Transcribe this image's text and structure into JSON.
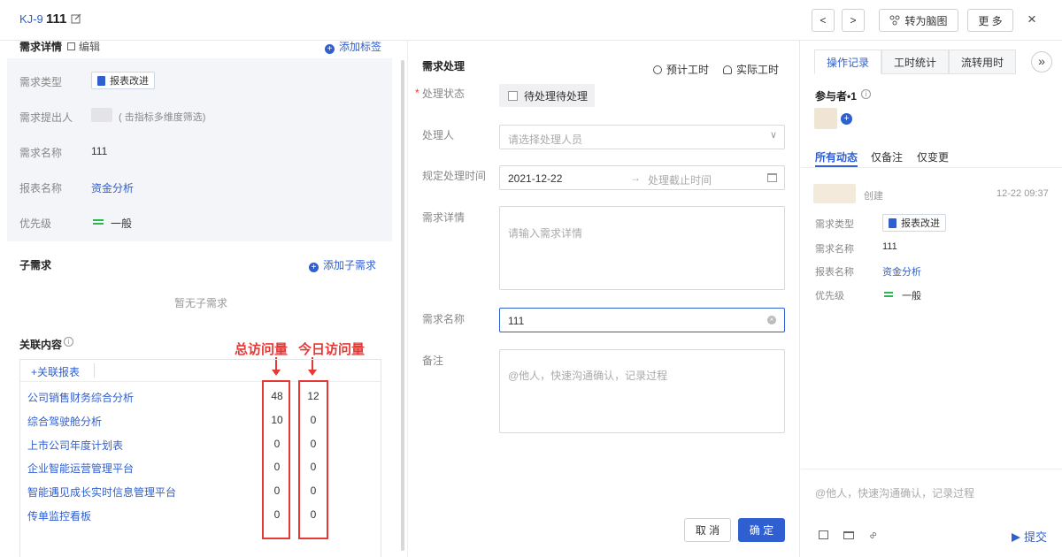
{
  "header": {
    "code": "KJ-9",
    "title": "111",
    "prev": "<",
    "next": ">",
    "mindmap": "转为脑图",
    "more": "更 多",
    "close": "×"
  },
  "detail": {
    "title": "需求详情",
    "edit": "编辑",
    "add_tag": "添加标签",
    "type_label": "需求类型",
    "type_value": "报表改进",
    "proposer_label": "需求提出人",
    "proposer_note": "( 击指标多维度筛选)",
    "name_label": "需求名称",
    "name_value": "111",
    "report_label": "报表名称",
    "report_value": "资金分析",
    "priority_label": "优先级",
    "priority_value": "一般"
  },
  "sub": {
    "title": "子需求",
    "add": "添加子需求",
    "empty": "暂无子需求"
  },
  "related": {
    "title": "关联内容",
    "add": "+关联报表",
    "annot_total": "总访问量",
    "annot_today": "今日访问量",
    "rows": [
      {
        "name": "公司销售财务综合分析",
        "total": "48",
        "today": "12"
      },
      {
        "name": "综合驾驶舱分析",
        "total": "10",
        "today": "0"
      },
      {
        "name": "上市公司年度计划表",
        "total": "0",
        "today": "0"
      },
      {
        "name": "企业智能运营管理平台",
        "total": "0",
        "today": "0"
      },
      {
        "name": "智能遇见成长实时信息管理平台",
        "total": "0",
        "today": "0"
      },
      {
        "name": "传单监控看板",
        "total": "0",
        "today": "0"
      }
    ]
  },
  "process": {
    "title": "需求处理",
    "est_time": "预计工时",
    "actual_time": "实际工时",
    "status_label": "处理状态",
    "status_value": "待处理待处理",
    "handler_label": "处理人",
    "handler_ph": "请选择处理人员",
    "time_label": "规定处理时间",
    "date_start": "2021-12-22",
    "date_end_ph": "处理截止时间",
    "detail_label": "需求详情",
    "detail_ph": "请输入需求详情",
    "name_label": "需求名称",
    "name_value": "111",
    "note_label": "备注",
    "note_ph": "@他人，快速沟通确认，记录过程",
    "cancel": "取 消",
    "confirm": "确 定"
  },
  "side": {
    "tabs": [
      "操作记录",
      "工时统计",
      "流转用时"
    ],
    "expand": "»",
    "participants": "参与者•1",
    "filters": [
      "所有动态",
      "仅备注",
      "仅变更"
    ],
    "created": "创建",
    "created_time": "12-22 09:37",
    "type_label": "需求类型",
    "type_value": "报表改进",
    "name_label": "需求名称",
    "name_value": "111",
    "report_label": "报表名称",
    "report_value": "资金分析",
    "priority_label": "优先级",
    "priority_value": "一般",
    "comment_ph": "@他人，快速沟通确认，记录过程",
    "submit": "提交"
  }
}
